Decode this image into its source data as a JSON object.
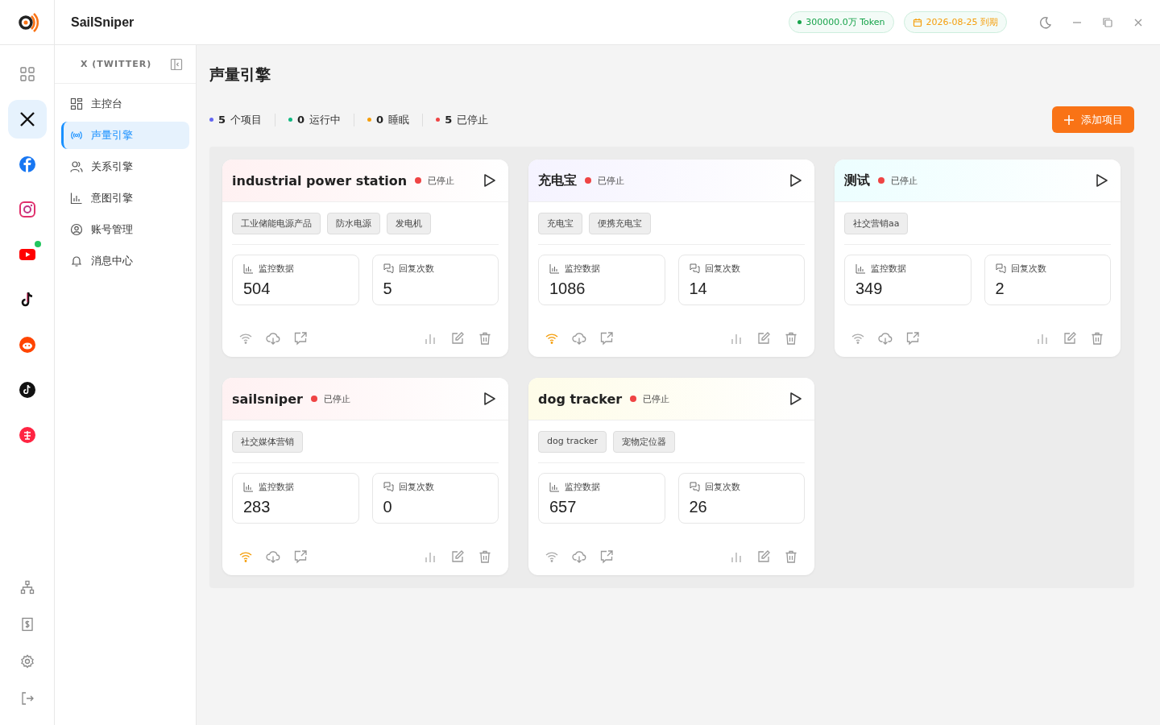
{
  "app": {
    "name": "SailSniper"
  },
  "header": {
    "token_badge": "300000.0万 Token",
    "expiry_badge": "2026-08-25 到期"
  },
  "platforms": [
    {
      "kind": "dashboard",
      "selected": false,
      "online": false
    },
    {
      "kind": "x",
      "selected": true,
      "online": false
    },
    {
      "kind": "facebook",
      "selected": false,
      "online": false
    },
    {
      "kind": "instagram",
      "selected": false,
      "online": false
    },
    {
      "kind": "youtube",
      "selected": false,
      "online": true
    },
    {
      "kind": "tiktok",
      "selected": false,
      "online": false
    },
    {
      "kind": "reddit",
      "selected": false,
      "online": false
    },
    {
      "kind": "tiktok-circle",
      "selected": false,
      "online": false
    },
    {
      "kind": "rednote",
      "selected": false,
      "online": false
    }
  ],
  "rail_bottom": [
    {
      "kind": "network"
    },
    {
      "kind": "billing"
    },
    {
      "kind": "settings"
    },
    {
      "kind": "logout"
    }
  ],
  "sidebar": {
    "title": "X (TWITTER)",
    "items": [
      {
        "kind": "grid",
        "label": "主控台",
        "selected": false
      },
      {
        "kind": "broadcast",
        "label": "声量引擎",
        "selected": true
      },
      {
        "kind": "users",
        "label": "关系引擎",
        "selected": false
      },
      {
        "kind": "chart",
        "label": "意图引擎",
        "selected": false
      },
      {
        "kind": "account",
        "label": "账号管理",
        "selected": false
      },
      {
        "kind": "bell",
        "label": "消息中心",
        "selected": false
      }
    ]
  },
  "page": {
    "title": "声量引擎",
    "add_button": "添加项目"
  },
  "stats": [
    {
      "count": "5",
      "label": "个项目",
      "color": "#6366f1"
    },
    {
      "count": "0",
      "label": "运行中",
      "color": "#10b981"
    },
    {
      "count": "0",
      "label": "睡眠",
      "color": "#f59e0b"
    },
    {
      "count": "5",
      "label": "已停止",
      "color": "#ef4444"
    }
  ],
  "projects": [
    {
      "name": "industrial power station",
      "status": "已停止",
      "stopped": true,
      "color": "#fff1f2",
      "tags": [
        "工业储能电源产品",
        "防水电源",
        "发电机"
      ],
      "monitor_label": "监控数据",
      "monitor": "504",
      "reply_label": "回复次数",
      "replies": "5",
      "wifi_active": false
    },
    {
      "name": "充电宝",
      "status": "已停止",
      "stopped": true,
      "color": "#f5f3ff",
      "tags": [
        "充电宝",
        "便携充电宝"
      ],
      "monitor_label": "监控数据",
      "monitor": "1086",
      "reply_label": "回复次数",
      "replies": "14",
      "wifi_active": true
    },
    {
      "name": "测试",
      "status": "已停止",
      "stopped": true,
      "color": "#ecfeff",
      "tags": [
        "社交营销aa"
      ],
      "monitor_label": "监控数据",
      "monitor": "349",
      "reply_label": "回复次数",
      "replies": "2",
      "wifi_active": false
    },
    {
      "name": "sailsniper",
      "status": "已停止",
      "stopped": true,
      "color": "#fff1f2",
      "tags": [
        "社交媒体营销"
      ],
      "monitor_label": "监控数据",
      "monitor": "283",
      "reply_label": "回复次数",
      "replies": "0",
      "wifi_active": true
    },
    {
      "name": "dog tracker",
      "status": "已停止",
      "stopped": true,
      "color": "#fefce8",
      "tags": [
        "dog tracker",
        "宠物定位器"
      ],
      "monitor_label": "监控数据",
      "monitor": "657",
      "reply_label": "回复次数",
      "replies": "26",
      "wifi_active": false
    }
  ]
}
